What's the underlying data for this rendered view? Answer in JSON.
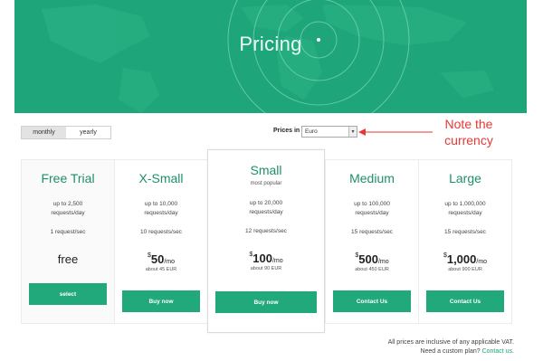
{
  "hero": {
    "title": "Pricing"
  },
  "billing_toggle": {
    "options": [
      "monthly",
      "yearly"
    ],
    "selected": "monthly"
  },
  "currency": {
    "label": "Prices in",
    "selected": "Euro"
  },
  "annotation": {
    "line1": "Note the",
    "line2": "currency",
    "color": "#e53935"
  },
  "plans": [
    {
      "name": "Free Trial",
      "subtitle": "",
      "requests1": "up to 2,500",
      "requests2": "requests/day",
      "rate": "1 request/sec",
      "currency_symbol": "",
      "amount": "free",
      "period": "",
      "about": "",
      "button": "select"
    },
    {
      "name": "X-Small",
      "subtitle": "",
      "requests1": "up to 10,000",
      "requests2": "requests/day",
      "rate": "10 requests/sec",
      "currency_symbol": "$",
      "amount": "50",
      "period": "/mo",
      "about": "about 45 EUR",
      "button": "Buy now"
    },
    {
      "name": "Small",
      "subtitle": "most popular",
      "requests1": "up to 20,000",
      "requests2": "requests/day",
      "rate": "12 requests/sec",
      "currency_symbol": "$",
      "amount": "100",
      "period": "/mo",
      "about": "about 90 EUR",
      "button": "Buy now"
    },
    {
      "name": "Medium",
      "subtitle": "",
      "requests1": "up to 100,000",
      "requests2": "requests/day",
      "rate": "15 requests/sec",
      "currency_symbol": "$",
      "amount": "500",
      "period": "/mo",
      "about": "about 450 EUR",
      "button": "Contact Us"
    },
    {
      "name": "Large",
      "subtitle": "",
      "requests1": "up to 1,000,000",
      "requests2": "requests/day",
      "rate": "15 requests/sec",
      "currency_symbol": "$",
      "amount": "1,000",
      "period": "/mo",
      "about": "about 900 EUR",
      "button": "Contact Us"
    }
  ],
  "footer": {
    "vat_note": "All prices are inclusive of any applicable VAT.",
    "custom_prefix": "Need a custom plan?",
    "custom_link": "Contact us."
  },
  "colors": {
    "brand": "#1fa57a",
    "button": "#21a87b",
    "heading": "#1e8f69"
  }
}
